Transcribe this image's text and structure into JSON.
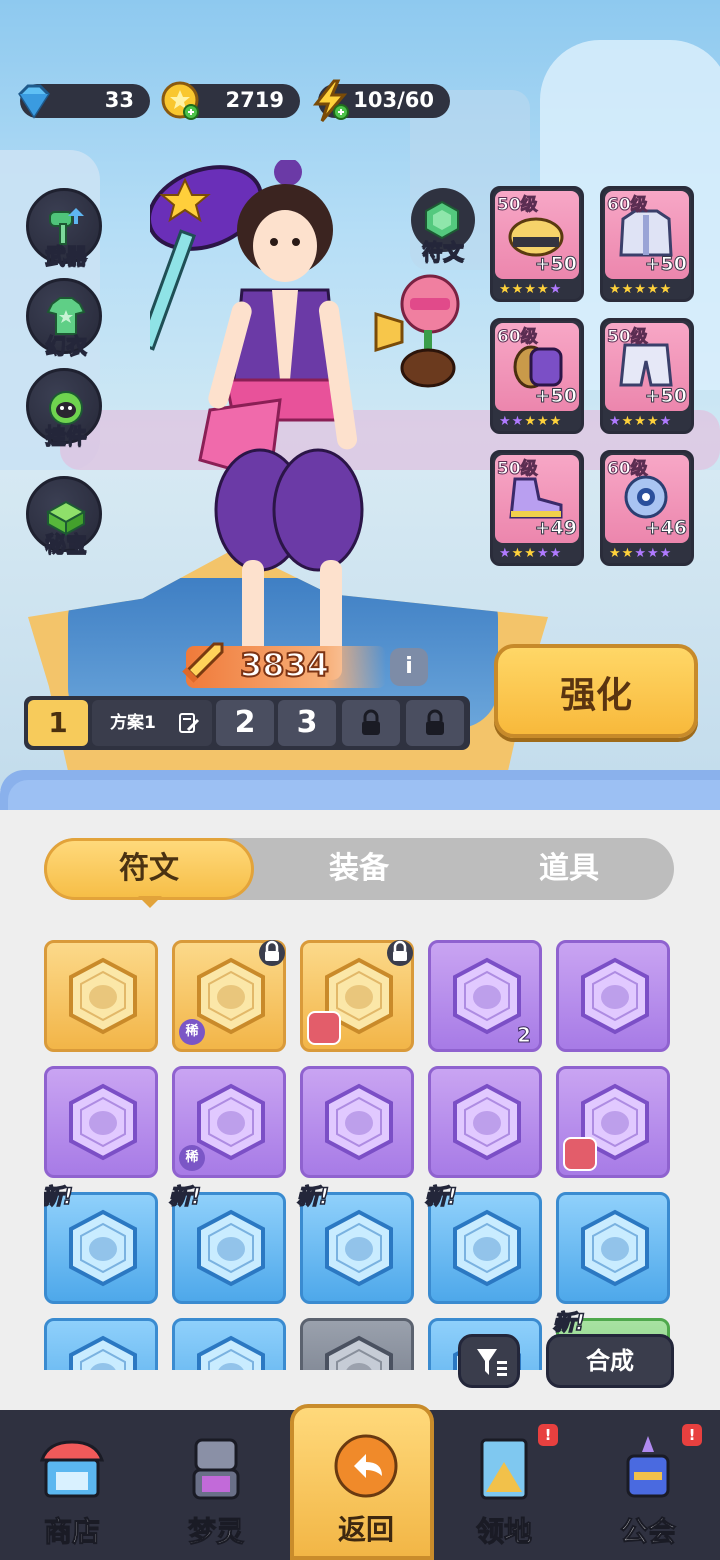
{
  "currency": {
    "gems": "33",
    "coins": "2719",
    "energy": "103/60"
  },
  "side_menu": [
    {
      "label": "武器",
      "icon": "hammer-icon"
    },
    {
      "label": "幻衣",
      "icon": "shirt-icon"
    },
    {
      "label": "挂件",
      "icon": "pendant-icon"
    },
    {
      "label": "秘宝",
      "icon": "treasure-icon"
    }
  ],
  "rune_button": {
    "label": "符文",
    "icon": "rune-icon"
  },
  "equipment": [
    {
      "level": "50级",
      "bonus": "+50",
      "slot": "helmet",
      "stars": 5
    },
    {
      "level": "60级",
      "bonus": "+50",
      "slot": "jacket",
      "stars": 5
    },
    {
      "level": "60级",
      "bonus": "+50",
      "slot": "bracer",
      "stars": 5
    },
    {
      "level": "50级",
      "bonus": "+50",
      "slot": "pants",
      "stars": 5
    },
    {
      "level": "50级",
      "bonus": "+49",
      "slot": "shoes",
      "stars": 5
    },
    {
      "level": "60级",
      "bonus": "+46",
      "slot": "orb",
      "stars": 5
    }
  ],
  "power": {
    "value": "3834",
    "info_icon": "i"
  },
  "enhance_label": "强化",
  "plans": {
    "current": "1",
    "name": "方案1",
    "others": [
      "2",
      "3"
    ]
  },
  "tabs": [
    "符文",
    "装备",
    "道具"
  ],
  "inventory": [
    {
      "rarity": "gold",
      "count": "",
      "rare_tag": "",
      "avatar": false,
      "locked": false,
      "new": ""
    },
    {
      "rarity": "gold",
      "count": "",
      "rare_tag": "稀",
      "avatar": false,
      "locked": true,
      "new": ""
    },
    {
      "rarity": "gold",
      "count": "",
      "rare_tag": "",
      "avatar": true,
      "locked": true,
      "new": ""
    },
    {
      "rarity": "purple",
      "count": "2",
      "rare_tag": "",
      "avatar": false,
      "locked": false,
      "new": ""
    },
    {
      "rarity": "purple",
      "count": "",
      "rare_tag": "",
      "avatar": false,
      "locked": false,
      "new": ""
    },
    {
      "rarity": "purple",
      "count": "",
      "rare_tag": "",
      "avatar": false,
      "locked": false,
      "new": ""
    },
    {
      "rarity": "purple",
      "count": "",
      "rare_tag": "稀",
      "avatar": false,
      "locked": false,
      "new": ""
    },
    {
      "rarity": "purple",
      "count": "",
      "rare_tag": "",
      "avatar": false,
      "locked": false,
      "new": ""
    },
    {
      "rarity": "purple",
      "count": "",
      "rare_tag": "",
      "avatar": false,
      "locked": false,
      "new": ""
    },
    {
      "rarity": "purple",
      "count": "",
      "rare_tag": "",
      "avatar": true,
      "locked": false,
      "new": ""
    },
    {
      "rarity": "blue",
      "count": "",
      "rare_tag": "",
      "avatar": false,
      "locked": false,
      "new": "新!"
    },
    {
      "rarity": "blue",
      "count": "",
      "rare_tag": "",
      "avatar": false,
      "locked": false,
      "new": "新!"
    },
    {
      "rarity": "blue",
      "count": "",
      "rare_tag": "",
      "avatar": false,
      "locked": false,
      "new": "新!"
    },
    {
      "rarity": "blue",
      "count": "",
      "rare_tag": "",
      "avatar": false,
      "locked": false,
      "new": "新!"
    },
    {
      "rarity": "blue",
      "count": "",
      "rare_tag": "",
      "avatar": false,
      "locked": false,
      "new": ""
    },
    {
      "rarity": "blue",
      "count": "",
      "rare_tag": "",
      "avatar": false,
      "locked": false,
      "new": ""
    },
    {
      "rarity": "blue",
      "count": "",
      "rare_tag": "",
      "avatar": false,
      "locked": false,
      "new": ""
    },
    {
      "rarity": "grey",
      "count": "",
      "rare_tag": "",
      "avatar": false,
      "locked": false,
      "new": ""
    },
    {
      "rarity": "blue",
      "count": "",
      "rare_tag": "",
      "avatar": false,
      "locked": false,
      "new": ""
    },
    {
      "rarity": "green",
      "count": "",
      "rare_tag": "",
      "avatar": false,
      "locked": false,
      "new": "新!"
    }
  ],
  "combine_label": "合成",
  "nav": [
    {
      "label": "商店",
      "icon": "shop-icon",
      "badge": ""
    },
    {
      "label": "梦灵",
      "icon": "robot-icon",
      "badge": ""
    },
    {
      "label": "返回",
      "icon": "back-arrow-icon",
      "badge": "",
      "active": true
    },
    {
      "label": "领地",
      "icon": "territory-icon",
      "badge": "!"
    },
    {
      "label": "公会",
      "icon": "guild-icon",
      "badge": "!"
    }
  ],
  "colors": {
    "gold": "#f2b548",
    "purple": "#a77be6",
    "blue": "#4ea8ea",
    "dark_ui": "#2f3240",
    "accent_yellow": "#f8b93b"
  }
}
